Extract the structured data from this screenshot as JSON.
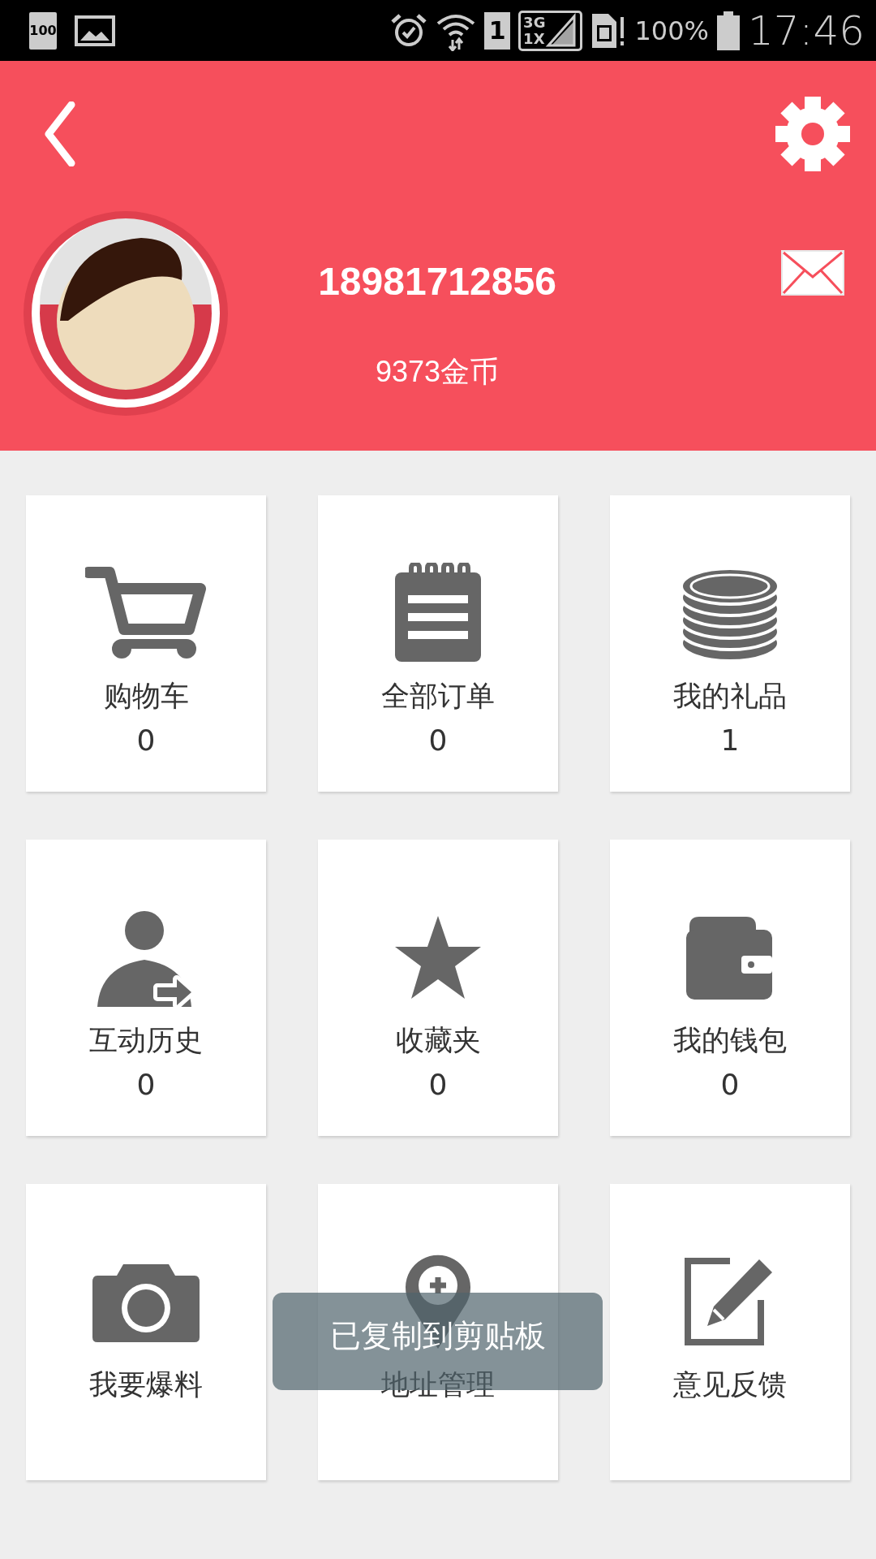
{
  "status_bar": {
    "battery_badge": "100",
    "sim_slot": "1",
    "network_top": "3G",
    "network_bottom": "1X",
    "battery_percent": "100%",
    "time": "17:46"
  },
  "profile": {
    "phone": "18981712856",
    "coins": "9373金币"
  },
  "tiles": [
    {
      "kind": "cart",
      "label": "购物车",
      "count": "0"
    },
    {
      "kind": "orders",
      "label": "全部订单",
      "count": "0"
    },
    {
      "kind": "gifts",
      "label": "我的礼品",
      "count": "1"
    },
    {
      "kind": "history",
      "label": "互动历史",
      "count": "0"
    },
    {
      "kind": "favorites",
      "label": "收藏夹",
      "count": "0"
    },
    {
      "kind": "wallet",
      "label": "我的钱包",
      "count": "0"
    },
    {
      "kind": "camera",
      "label": "我要爆料"
    },
    {
      "kind": "address",
      "label": "地址管理"
    },
    {
      "kind": "feedback",
      "label": "意见反馈"
    }
  ],
  "toast": {
    "text": "已复制到剪贴板"
  }
}
